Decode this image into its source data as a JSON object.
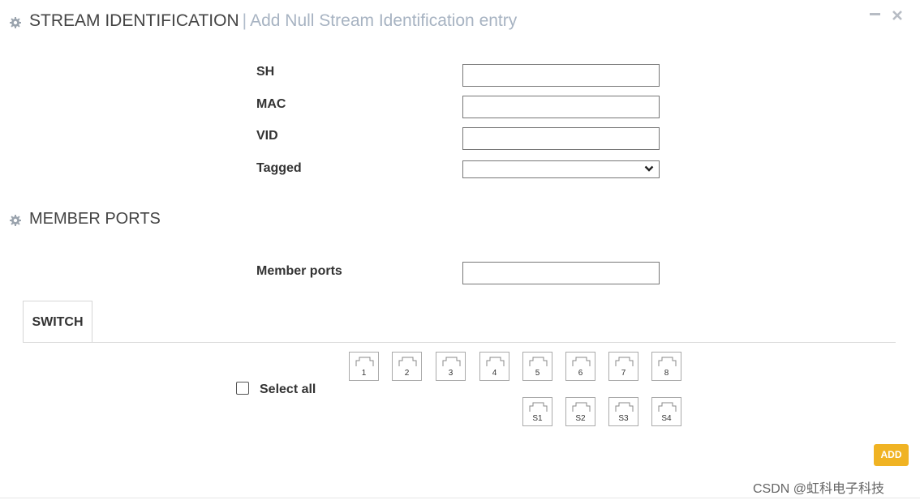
{
  "header": {
    "icon": "gear-icon",
    "title": "STREAM IDENTIFICATION",
    "separator": "|",
    "subtitle": "Add Null Stream Identification entry",
    "minimize_icon": "minimize-icon",
    "close_icon": "close-icon"
  },
  "form": {
    "fields": [
      {
        "label": "SH",
        "value": ""
      },
      {
        "label": "MAC",
        "value": ""
      },
      {
        "label": "VID",
        "value": ""
      }
    ],
    "tagged": {
      "label": "Tagged",
      "value": ""
    }
  },
  "member_ports_section": {
    "icon": "gear-icon",
    "title": "MEMBER PORTS",
    "field": {
      "label": "Member ports",
      "value": ""
    }
  },
  "tabs": [
    {
      "label": "SWITCH",
      "active": true
    }
  ],
  "switch": {
    "select_all_label": "Select all",
    "select_all_checked": false,
    "ports_row1": [
      "1",
      "2",
      "3",
      "4",
      "5",
      "6",
      "7",
      "8"
    ],
    "ports_row2": [
      "S1",
      "S2",
      "S3",
      "S4"
    ]
  },
  "actions": {
    "add_label": "ADD"
  },
  "watermark": "CSDN @虹科电子科技",
  "colors": {
    "accent": "#f0b323",
    "subtitle": "#a7b3c2",
    "text": "#333333"
  }
}
